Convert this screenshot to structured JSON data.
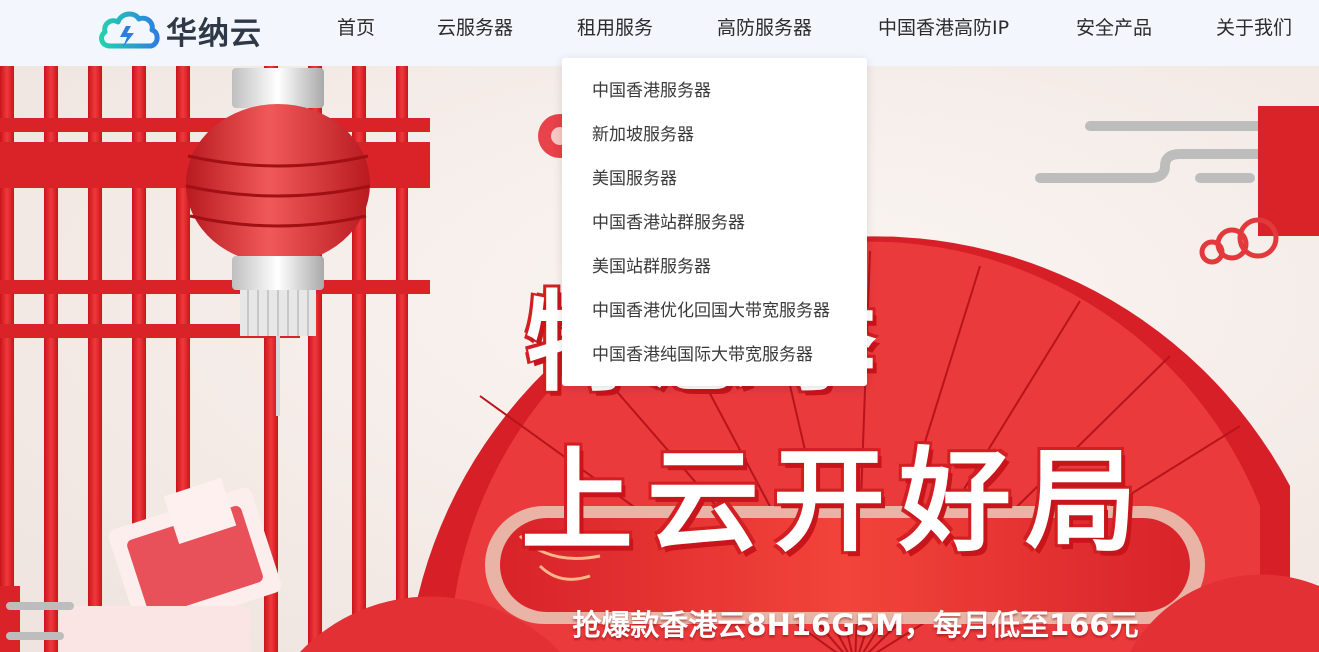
{
  "brand": {
    "name": "华纳云"
  },
  "nav": {
    "items": [
      {
        "label": "首页"
      },
      {
        "label": "云服务器"
      },
      {
        "label": "租用服务"
      },
      {
        "label": "高防服务器"
      },
      {
        "label": "中国香港高防IP"
      },
      {
        "label": "安全产品"
      },
      {
        "label": "关于我们"
      }
    ],
    "active_dropdown": {
      "items": [
        {
          "label": "中国香港服务器"
        },
        {
          "label": "新加坡服务器"
        },
        {
          "label": "美国服务器"
        },
        {
          "label": "中国香港站群服务器"
        },
        {
          "label": "美国站群服务器"
        },
        {
          "label": "中国香港优化回国大带宽服务器"
        },
        {
          "label": "中国香港纯国际大带宽服务器"
        }
      ]
    }
  },
  "banner": {
    "headline_line1": "特惠季",
    "headline_line2": "上云开好局",
    "promo": "抢爆款香港云8H16G5M，每月低至166元"
  },
  "colors": {
    "brand_red": "#e3262c",
    "logo_teal": "#27c3b5",
    "logo_blue": "#2f7fe0",
    "header_bg": "#f3f7fd"
  }
}
